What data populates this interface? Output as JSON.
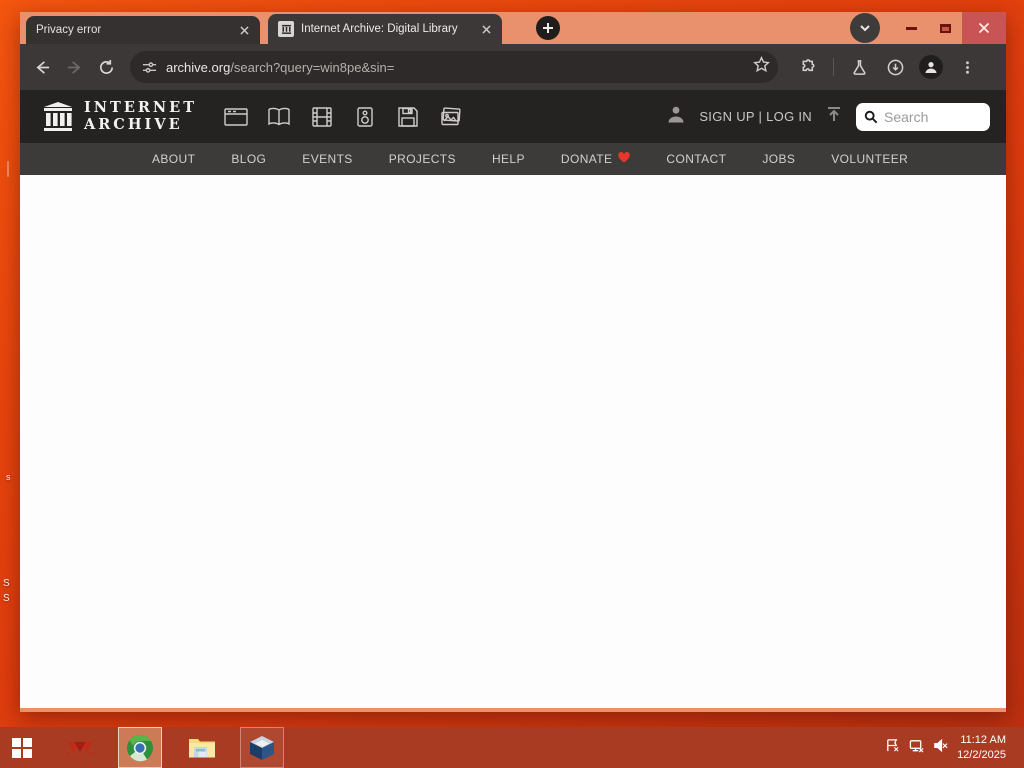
{
  "desktop": {
    "icon_label_fragments": [
      {
        "text": "s"
      },
      {
        "text": "S"
      },
      {
        "text": "S"
      }
    ]
  },
  "browser": {
    "tabs": [
      {
        "title": "Privacy error",
        "active": false
      },
      {
        "title": "Internet Archive: Digital Library",
        "active": true,
        "favicon": "internet-archive-building"
      }
    ],
    "url_domain": "archive.org",
    "url_path": "/search?query=win8pe&sin=",
    "url_full": "archive.org/search?query=win8pe&sin="
  },
  "archive_header": {
    "wordmark_line1": "INTERNET",
    "wordmark_line2": "ARCHIVE",
    "media_types": [
      "web",
      "texts",
      "video",
      "audio",
      "software",
      "images"
    ],
    "signup_login": "SIGN UP | LOG IN",
    "search_placeholder": "Search"
  },
  "nav": {
    "items": [
      {
        "label": "ABOUT"
      },
      {
        "label": "BLOG"
      },
      {
        "label": "EVENTS"
      },
      {
        "label": "PROJECTS"
      },
      {
        "label": "HELP"
      },
      {
        "label": "DONATE",
        "has_heart": true
      },
      {
        "label": "CONTACT"
      },
      {
        "label": "JOBS"
      },
      {
        "label": "VOLUNTEER"
      }
    ],
    "heart_color": "#e8362c"
  },
  "taskbar": {
    "apps": [
      "start",
      "red-app",
      "chrome",
      "file-explorer",
      "virtualbox"
    ],
    "active_app": "chrome",
    "tray_icons": [
      "action-center-flag",
      "network-status",
      "volume-muted"
    ],
    "time": "11:12 AM",
    "date": "12/2/2025"
  },
  "colors": {
    "desktop_orange": "#e8450d",
    "window_frame_salmon": "#e9916d",
    "chrome_dark": "#3b3837",
    "omnibox_dark": "#2d2a29",
    "ia_header_dark": "#252322",
    "ia_nav_gray": "#3d3b3a",
    "taskbar_red": "#a93b22",
    "close_button_red": "#c95456",
    "donate_heart_red": "#e8362c"
  }
}
